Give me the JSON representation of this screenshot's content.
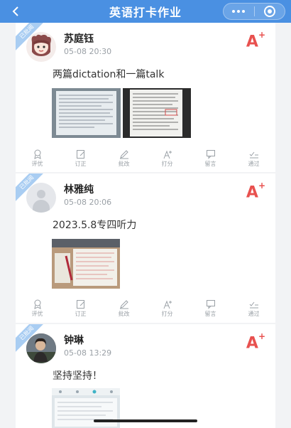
{
  "header": {
    "title": "英语打卡作业"
  },
  "ribbon_label": "已批阅",
  "actions": [
    {
      "key": "comment",
      "label": "评优"
    },
    {
      "key": "correct",
      "label": "订正"
    },
    {
      "key": "review",
      "label": "批改"
    },
    {
      "key": "score",
      "label": "打分"
    },
    {
      "key": "message",
      "label": "留言"
    },
    {
      "key": "pass",
      "label": "通过"
    }
  ],
  "posts": [
    {
      "name": "苏庭钰",
      "time": "05-08 20:30",
      "grade": "A",
      "grade_mod": "+",
      "content": "两篇dictation和一篇talk",
      "images": 2
    },
    {
      "name": "林雅纯",
      "time": "05-08 20:06",
      "grade": "A",
      "grade_mod": "+",
      "content": "2023.5.8专四听力",
      "images": 1
    },
    {
      "name": "钟琳",
      "time": "05-08 13:29",
      "grade": "A",
      "grade_mod": "+",
      "content": "坚持坚持！",
      "images": 1
    }
  ]
}
